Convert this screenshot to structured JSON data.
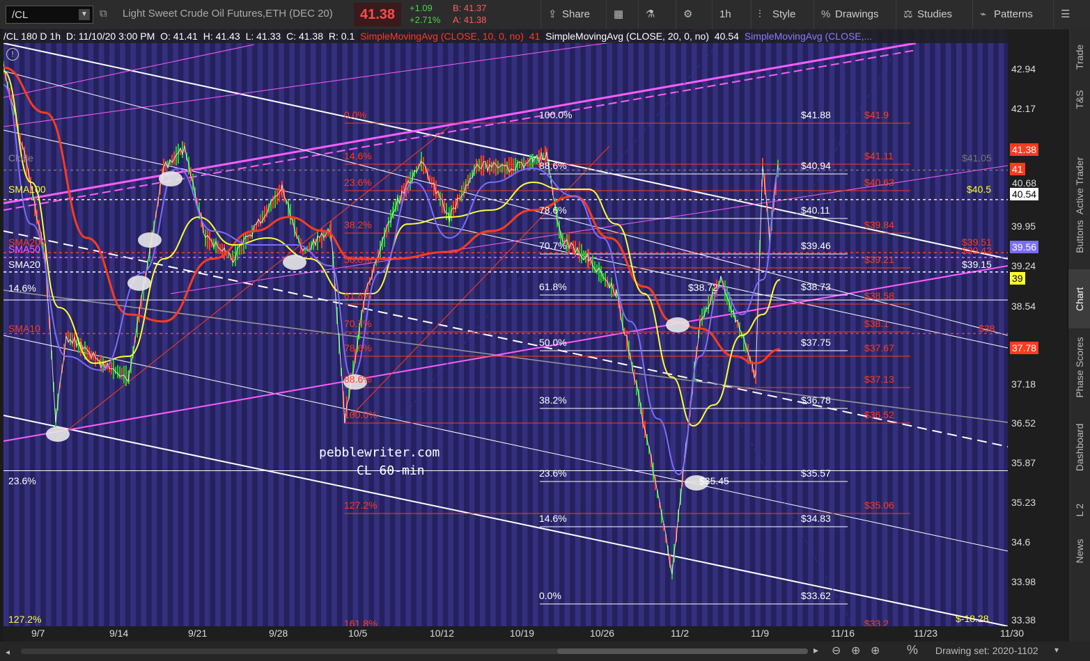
{
  "toolbar": {
    "symbol": "/CL",
    "description": "Light Sweet Crude Oil Futures,ETH (DEC 20)",
    "last": "41.38",
    "change": "+1.09",
    "change_pct": "+2.71%",
    "bid": "B: 41.37",
    "ask": "A: 41.38",
    "share": "Share",
    "timeframe": "1h",
    "style": "Style",
    "drawings": "Drawings",
    "studies": "Studies",
    "patterns": "Patterns"
  },
  "header": {
    "symbol_period": "/CL 180 D 1h",
    "datetime": "D: 11/10/20 3:00 PM",
    "open": "O: 41.41",
    "high": "H: 41.43",
    "low": "L: 41.33",
    "close": "C: 41.38",
    "range": "R: 0.1",
    "sma10": "SimpleMovingAvg (CLOSE, 10, 0, no)",
    "sma10_val": "41",
    "sma20": "SimpleMovingAvg (CLOSE, 20, 0, no)",
    "sma20_val": "40.54",
    "sma50": "SimpleMovingAvg (CLOSE,..."
  },
  "watermark": {
    "line1": "pebblewriter.com",
    "line2": "CL 60-min"
  },
  "left_labels": {
    "close": "Close",
    "sma100": "SMA100",
    "sma200": "SMA200",
    "sma50": "SMA50",
    "sma20": "SMA20",
    "sma10": "SMA10",
    "f146": "14.6%",
    "f236": "23.6%",
    "f1272": "127.2%"
  },
  "fib_white": [
    {
      "pct": "100.0%",
      "price": "$41.88"
    },
    {
      "pct": "88.6%",
      "price": "$40.94"
    },
    {
      "pct": "78.6%",
      "price": "$40.11"
    },
    {
      "pct": "70.7%",
      "price": "$39.46"
    },
    {
      "pct": "61.8%",
      "price": "$38.73"
    },
    {
      "pct": "50.0%",
      "price": "$37.75"
    },
    {
      "pct": "38.2%",
      "price": "$36.78"
    },
    {
      "pct": "23.6%",
      "price": "$35.57"
    },
    {
      "pct": "14.6%",
      "price": "$34.83"
    },
    {
      "pct": "0.0%",
      "price": "$33.62"
    }
  ],
  "fib_red": [
    {
      "pct": "0.0%",
      "price": "$41.9"
    },
    {
      "pct": "14.6%",
      "price": "$41.11"
    },
    {
      "pct": "23.6%",
      "price": "$40.63"
    },
    {
      "pct": "38.2%",
      "price": "$39.84"
    },
    {
      "pct": "50.0%",
      "price": "$39.21"
    },
    {
      "pct": "61.8%",
      "price": "$38.58"
    },
    {
      "pct": "70.7%",
      "price": "$38.1"
    },
    {
      "pct": "78.6%",
      "price": "$37.67"
    },
    {
      "pct": "88.6%",
      "price": "$37.13"
    },
    {
      "pct": "100.0%",
      "price": "$36.52"
    },
    {
      "pct": "127.2%",
      "price": "$35.06"
    },
    {
      "pct": "161.8%",
      "price": "$33.2"
    }
  ],
  "annotations": {
    "low_marker": "$38.72",
    "low2_marker": "$35.45",
    "r395": "$39.51",
    "r3942": "$39.42",
    "w3915": "$39.15",
    "y405": "$40.5",
    "r38": "$38",
    "g4105": "$41.05",
    "neg": "$-18.28"
  },
  "price_axis": [
    "42.94",
    "42.17",
    "39.95",
    "39.24",
    "38.54",
    "37.18",
    "36.52",
    "35.87",
    "35.23",
    "34.6",
    "33.98",
    "33.38"
  ],
  "price_tags": {
    "last": "41.38",
    "sma10": "41",
    "sma20": "40.54",
    "sma50": "39.56",
    "sma100": "39",
    "sma200": "37.78",
    "hidden": "40.68"
  },
  "date_axis": [
    "9/7",
    "9/14",
    "9/21",
    "9/28",
    "10/5",
    "10/12",
    "10/19",
    "10/26",
    "11/2",
    "11/9",
    "11/16",
    "11/23",
    "11/30"
  ],
  "right_tabs": [
    "Trade",
    "T&S",
    "Active Trader",
    "Buttons",
    "Chart",
    "Phase Scores",
    "Dashboard",
    "L 2",
    "News"
  ],
  "footer": {
    "drawing_set": "Drawing set: 2020-1102"
  },
  "colors": {
    "bg": "#25215e",
    "stripe": "#3b3588",
    "price_line": "#ff6b6b",
    "sma10": "#ff3b1f",
    "sma20": "#7c6cff",
    "sma50": "#ffff33",
    "white": "#ffffff",
    "magenta": "#ff5cff"
  }
}
